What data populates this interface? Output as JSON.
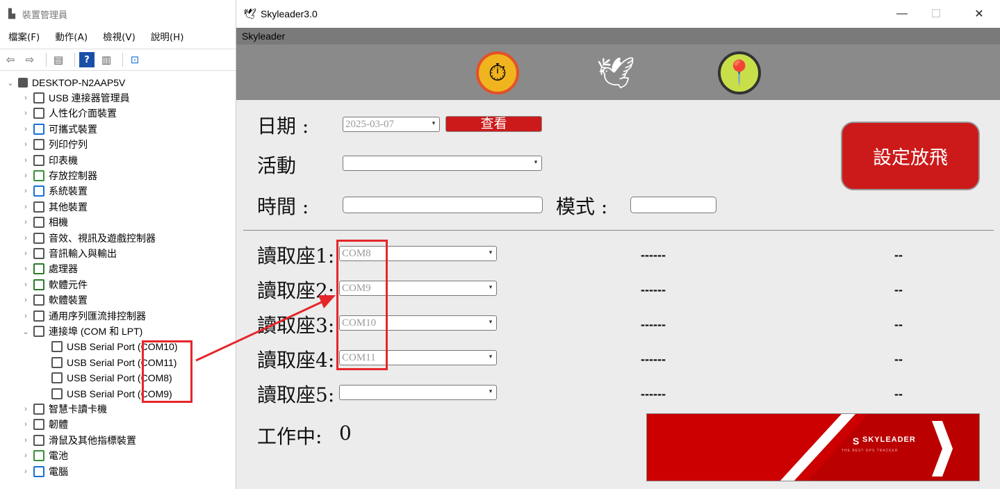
{
  "device_manager": {
    "title": "裝置管理員",
    "menu": [
      "檔案(F)",
      "動作(A)",
      "檢視(V)",
      "說明(H)"
    ],
    "root": "DESKTOP-N2AAP5V",
    "items": [
      {
        "label": "USB 連接器管理員",
        "icon": "usb-connector-icon",
        "color": "#555"
      },
      {
        "label": "人性化介面裝置",
        "icon": "hid-icon",
        "color": "#555"
      },
      {
        "label": "可攜式裝置",
        "icon": "portable-device-icon",
        "color": "#1a6fd1"
      },
      {
        "label": "列印佇列",
        "icon": "print-queue-icon",
        "color": "#555"
      },
      {
        "label": "印表機",
        "icon": "printer-icon",
        "color": "#555"
      },
      {
        "label": "存放控制器",
        "icon": "storage-controller-icon",
        "color": "#3a8f3a"
      },
      {
        "label": "系統裝置",
        "icon": "system-device-icon",
        "color": "#1a6fd1"
      },
      {
        "label": "其他裝置",
        "icon": "other-device-icon",
        "color": "#555"
      },
      {
        "label": "相機",
        "icon": "camera-icon",
        "color": "#555"
      },
      {
        "label": "音效、視訊及遊戲控制器",
        "icon": "sound-icon",
        "color": "#555"
      },
      {
        "label": "音訊輸入與輸出",
        "icon": "audio-io-icon",
        "color": "#555"
      },
      {
        "label": "處理器",
        "icon": "processor-icon",
        "color": "#2a7a2a"
      },
      {
        "label": "軟體元件",
        "icon": "software-component-icon",
        "color": "#2a7a2a"
      },
      {
        "label": "軟體裝置",
        "icon": "software-device-icon",
        "color": "#555"
      },
      {
        "label": "通用序列匯流排控制器",
        "icon": "usb-controller-icon",
        "color": "#555"
      },
      {
        "label": "連接埠 (COM 和 LPT)",
        "icon": "port-icon",
        "color": "#555",
        "expanded": true
      },
      {
        "label": "USB Serial Port (COM10)",
        "icon": "serial-port-icon",
        "color": "#555",
        "child": true
      },
      {
        "label": "USB Serial Port (COM11)",
        "icon": "serial-port-icon",
        "color": "#555",
        "child": true
      },
      {
        "label": "USB Serial Port (COM8)",
        "icon": "serial-port-icon",
        "color": "#555",
        "child": true
      },
      {
        "label": "USB Serial Port (COM9)",
        "icon": "serial-port-icon",
        "color": "#555",
        "child": true
      },
      {
        "label": "智慧卡讀卡機",
        "icon": "smart-card-icon",
        "color": "#555"
      },
      {
        "label": "韌體",
        "icon": "firmware-icon",
        "color": "#555"
      },
      {
        "label": "滑鼠及其他指標裝置",
        "icon": "mouse-icon",
        "color": "#555"
      },
      {
        "label": "電池",
        "icon": "battery-icon",
        "color": "#3a8f3a"
      },
      {
        "label": "電腦",
        "icon": "computer-icon",
        "color": "#1a6fd1"
      }
    ]
  },
  "app": {
    "title": "Skyleader3.0",
    "subtitle": "Skyleader",
    "top_icons": [
      "stopwatch-gear-icon",
      "pigeon-icon",
      "map-search-icon"
    ],
    "date_label": "日期 :",
    "date_value": "2025-03-07",
    "view_button": "查看",
    "activity_label": "活動",
    "time_label": "時間 :",
    "mode_label": "模式 :",
    "set_button": "設定放飛",
    "readers": [
      {
        "label": "讀取座1:",
        "port": "COM8",
        "status": "------",
        "value": "--"
      },
      {
        "label": "讀取座2:",
        "port": "COM9",
        "status": "------",
        "value": "--"
      },
      {
        "label": "讀取座3:",
        "port": "COM10",
        "status": "------",
        "value": "--"
      },
      {
        "label": "讀取座4:",
        "port": "COM11",
        "status": "------",
        "value": "--"
      },
      {
        "label": "讀取座5:",
        "port": "",
        "status": "------",
        "value": "--"
      }
    ],
    "working_label": "工作中:",
    "working_count": "0",
    "banner": {
      "brand": "SKYLEADER",
      "tagline": "THE BEST GPS TRACKER"
    },
    "colors": {
      "accent_red": "#cc1a1a",
      "highlight_red": "#e5262a"
    }
  }
}
